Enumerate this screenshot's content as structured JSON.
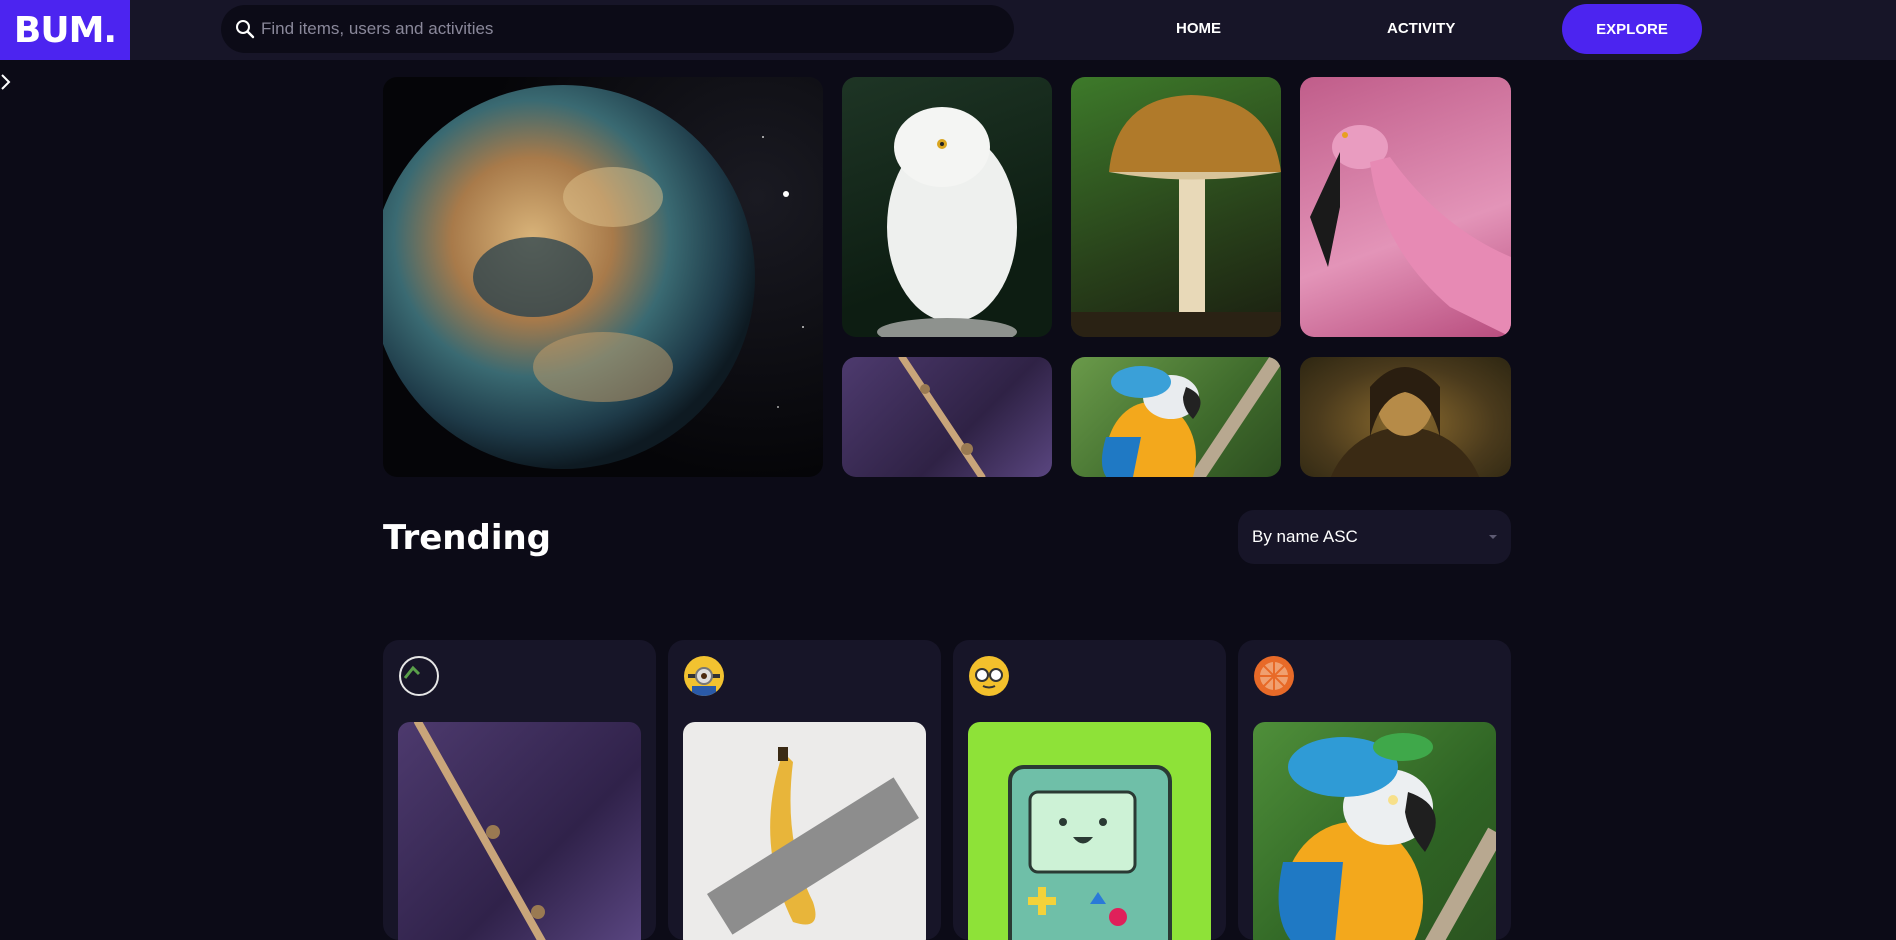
{
  "header": {
    "logo": "BUM.",
    "search_placeholder": "Find items, users and activities",
    "nav": {
      "home": "HOME",
      "activity": "ACTIVITY",
      "explore": "EXPLORE"
    }
  },
  "hero": {
    "tiles": [
      "planet",
      "snowy-owl",
      "mushroom",
      "flamingo",
      "wand",
      "macaw",
      "mona-lisa"
    ]
  },
  "trending": {
    "title": "Trending",
    "sort": {
      "selected": "By name ASC"
    },
    "cards": [
      {
        "avatar": "broken-avatar",
        "art": "wand"
      },
      {
        "avatar": "minion",
        "art": "taped-banana"
      },
      {
        "avatar": "emoji-face",
        "art": "bmo"
      },
      {
        "avatar": "orange-slice",
        "art": "macaw"
      }
    ]
  },
  "colors": {
    "accent": "#4c24f0",
    "background": "#0c0b17",
    "panel": "#171528"
  }
}
